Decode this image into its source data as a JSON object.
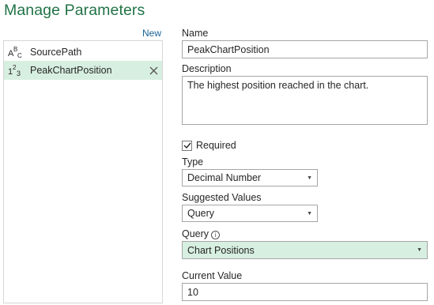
{
  "title": "Manage Parameters",
  "new_label": "New",
  "parameters": [
    {
      "icon": "text-type-icon",
      "label": "SourcePath",
      "selected": false
    },
    {
      "icon": "number-type-icon",
      "label": "PeakChartPosition",
      "selected": true
    }
  ],
  "form": {
    "name_label": "Name",
    "name_value": "PeakChartPosition",
    "description_label": "Description",
    "description_value": "The highest position reached in the chart.",
    "required_label": "Required",
    "required_checked": true,
    "type_label": "Type",
    "type_value": "Decimal Number",
    "suggested_label": "Suggested Values",
    "suggested_value": "Query",
    "query_label": "Query",
    "query_value": "Chart Positions",
    "current_label": "Current Value",
    "current_value": "10"
  },
  "colors": {
    "accent": "#217346",
    "selected_bg": "#d7efe0",
    "link": "#1a6496"
  }
}
